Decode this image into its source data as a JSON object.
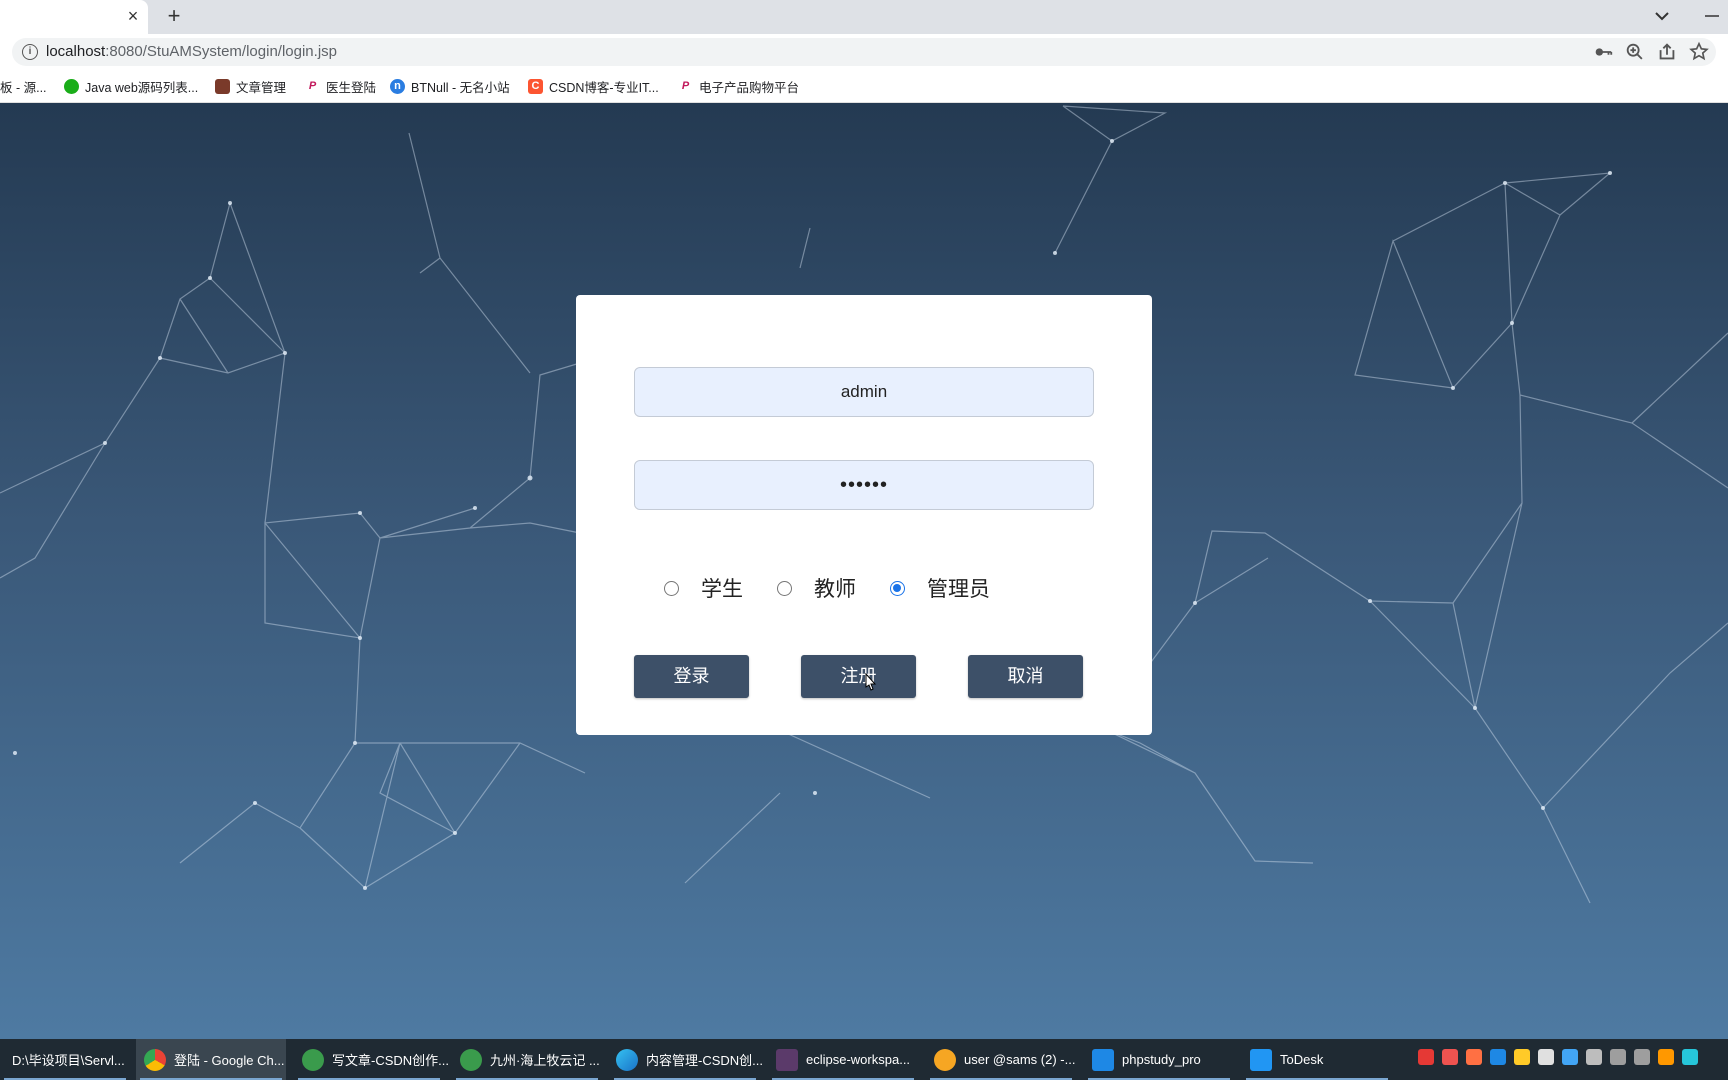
{
  "browser": {
    "tab_close": "×",
    "new_tab": "+",
    "url_host": "localhost",
    "url_path": ":8080/StuAMSystem/login/login.jsp",
    "bookmarks": [
      {
        "label": "板 - 源...",
        "icon": "folder-icon"
      },
      {
        "label": "Java web源码列表...",
        "icon": "wechat-icon"
      },
      {
        "label": "文章管理",
        "icon": "pen-icon"
      },
      {
        "label": "医生登陆",
        "icon": "pin-icon"
      },
      {
        "label": "BTNull - 无名小站",
        "icon": "btnull-icon"
      },
      {
        "label": "CSDN博客-专业IT...",
        "icon": "csdn-icon"
      },
      {
        "label": "电子产品购物平台",
        "icon": "pin-icon"
      }
    ]
  },
  "login": {
    "username_value": "admin",
    "password_value": "••••••",
    "roles": [
      {
        "label": "学生",
        "checked": false
      },
      {
        "label": "教师",
        "checked": false
      },
      {
        "label": "管理员",
        "checked": true
      }
    ],
    "buttons": {
      "login": "登录",
      "register": "注册",
      "cancel": "取消"
    }
  },
  "taskbar": {
    "items": [
      {
        "label": "D:\\毕设项目\\Servl...",
        "icon": "folder-icon"
      },
      {
        "label": "登陆 - Google Ch...",
        "icon": "chrome-icon"
      },
      {
        "label": "写文章-CSDN创作...",
        "icon": "browser-icon"
      },
      {
        "label": "九州·海上牧云记 ...",
        "icon": "browser-icon"
      },
      {
        "label": "内容管理-CSDN创...",
        "icon": "edge-icon"
      },
      {
        "label": "eclipse-workspa...",
        "icon": "eclipse-icon"
      },
      {
        "label": "user @sams (2) -...",
        "icon": "database-icon"
      },
      {
        "label": "phpstudy_pro",
        "icon": "phpstudy-icon"
      },
      {
        "label": "ToDesk",
        "icon": "todesk-icon"
      }
    ]
  },
  "colors": {
    "button_bg": "#3d5068",
    "input_bg": "#e8f0fe",
    "radio_checked": "#1a73e8"
  }
}
